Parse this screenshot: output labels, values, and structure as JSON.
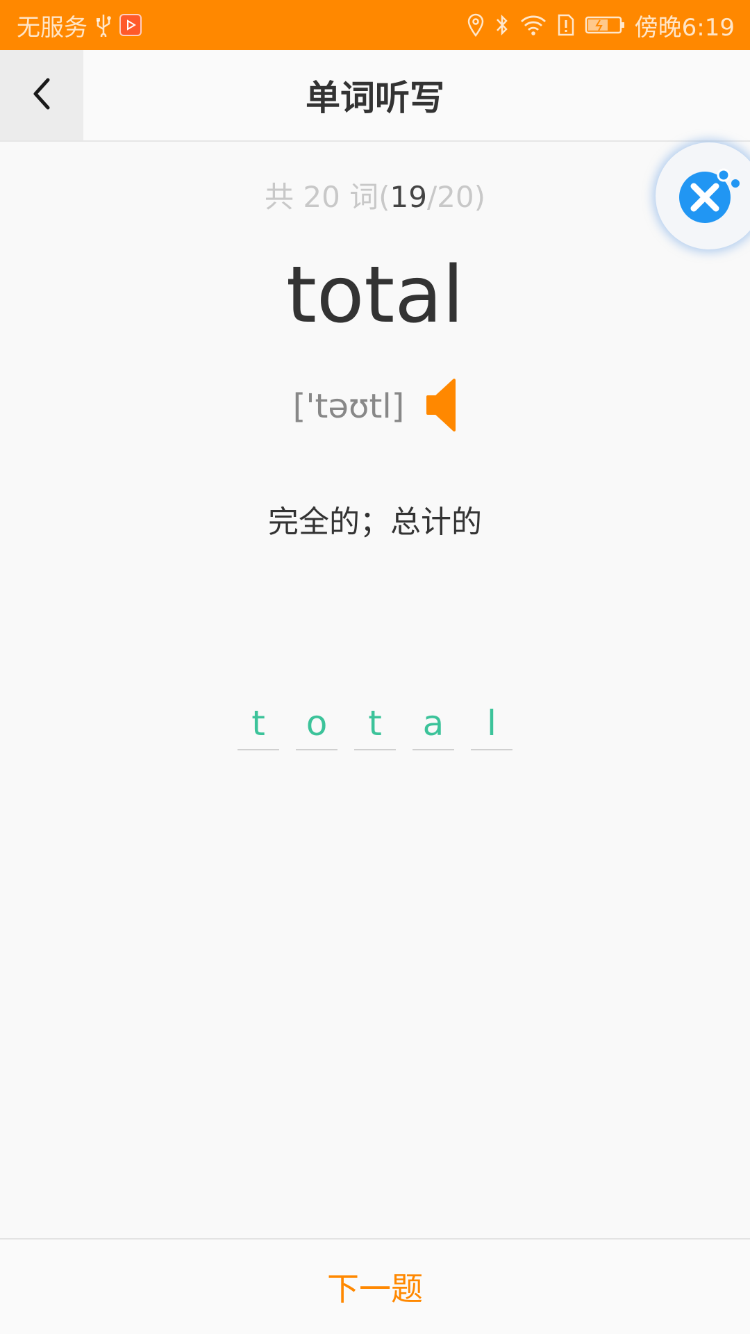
{
  "status_bar": {
    "carrier": "无服务",
    "time": "傍晚6:19",
    "icons": [
      "usb-icon",
      "app-notification-icon",
      "location-icon",
      "bluetooth-icon",
      "wifi-icon",
      "sim-alert-icon",
      "battery-icon"
    ]
  },
  "header": {
    "title": "单词听写",
    "back_icon": "chevron-left-icon"
  },
  "floating_button": {
    "icon": "tools-icon",
    "color": "#2196f3"
  },
  "progress": {
    "prefix": "共 20 词(",
    "current": "19",
    "suffix": "/20)"
  },
  "word": {
    "text": "total",
    "phonetic": "['təʊtl]",
    "speaker_icon": "speaker-icon",
    "meaning": "完全的；总计的"
  },
  "answer_letters": [
    "t",
    "o",
    "t",
    "a",
    "l"
  ],
  "footer": {
    "next_label": "下一题"
  },
  "colors": {
    "accent": "#ff8800",
    "answer": "#3cc39a"
  }
}
